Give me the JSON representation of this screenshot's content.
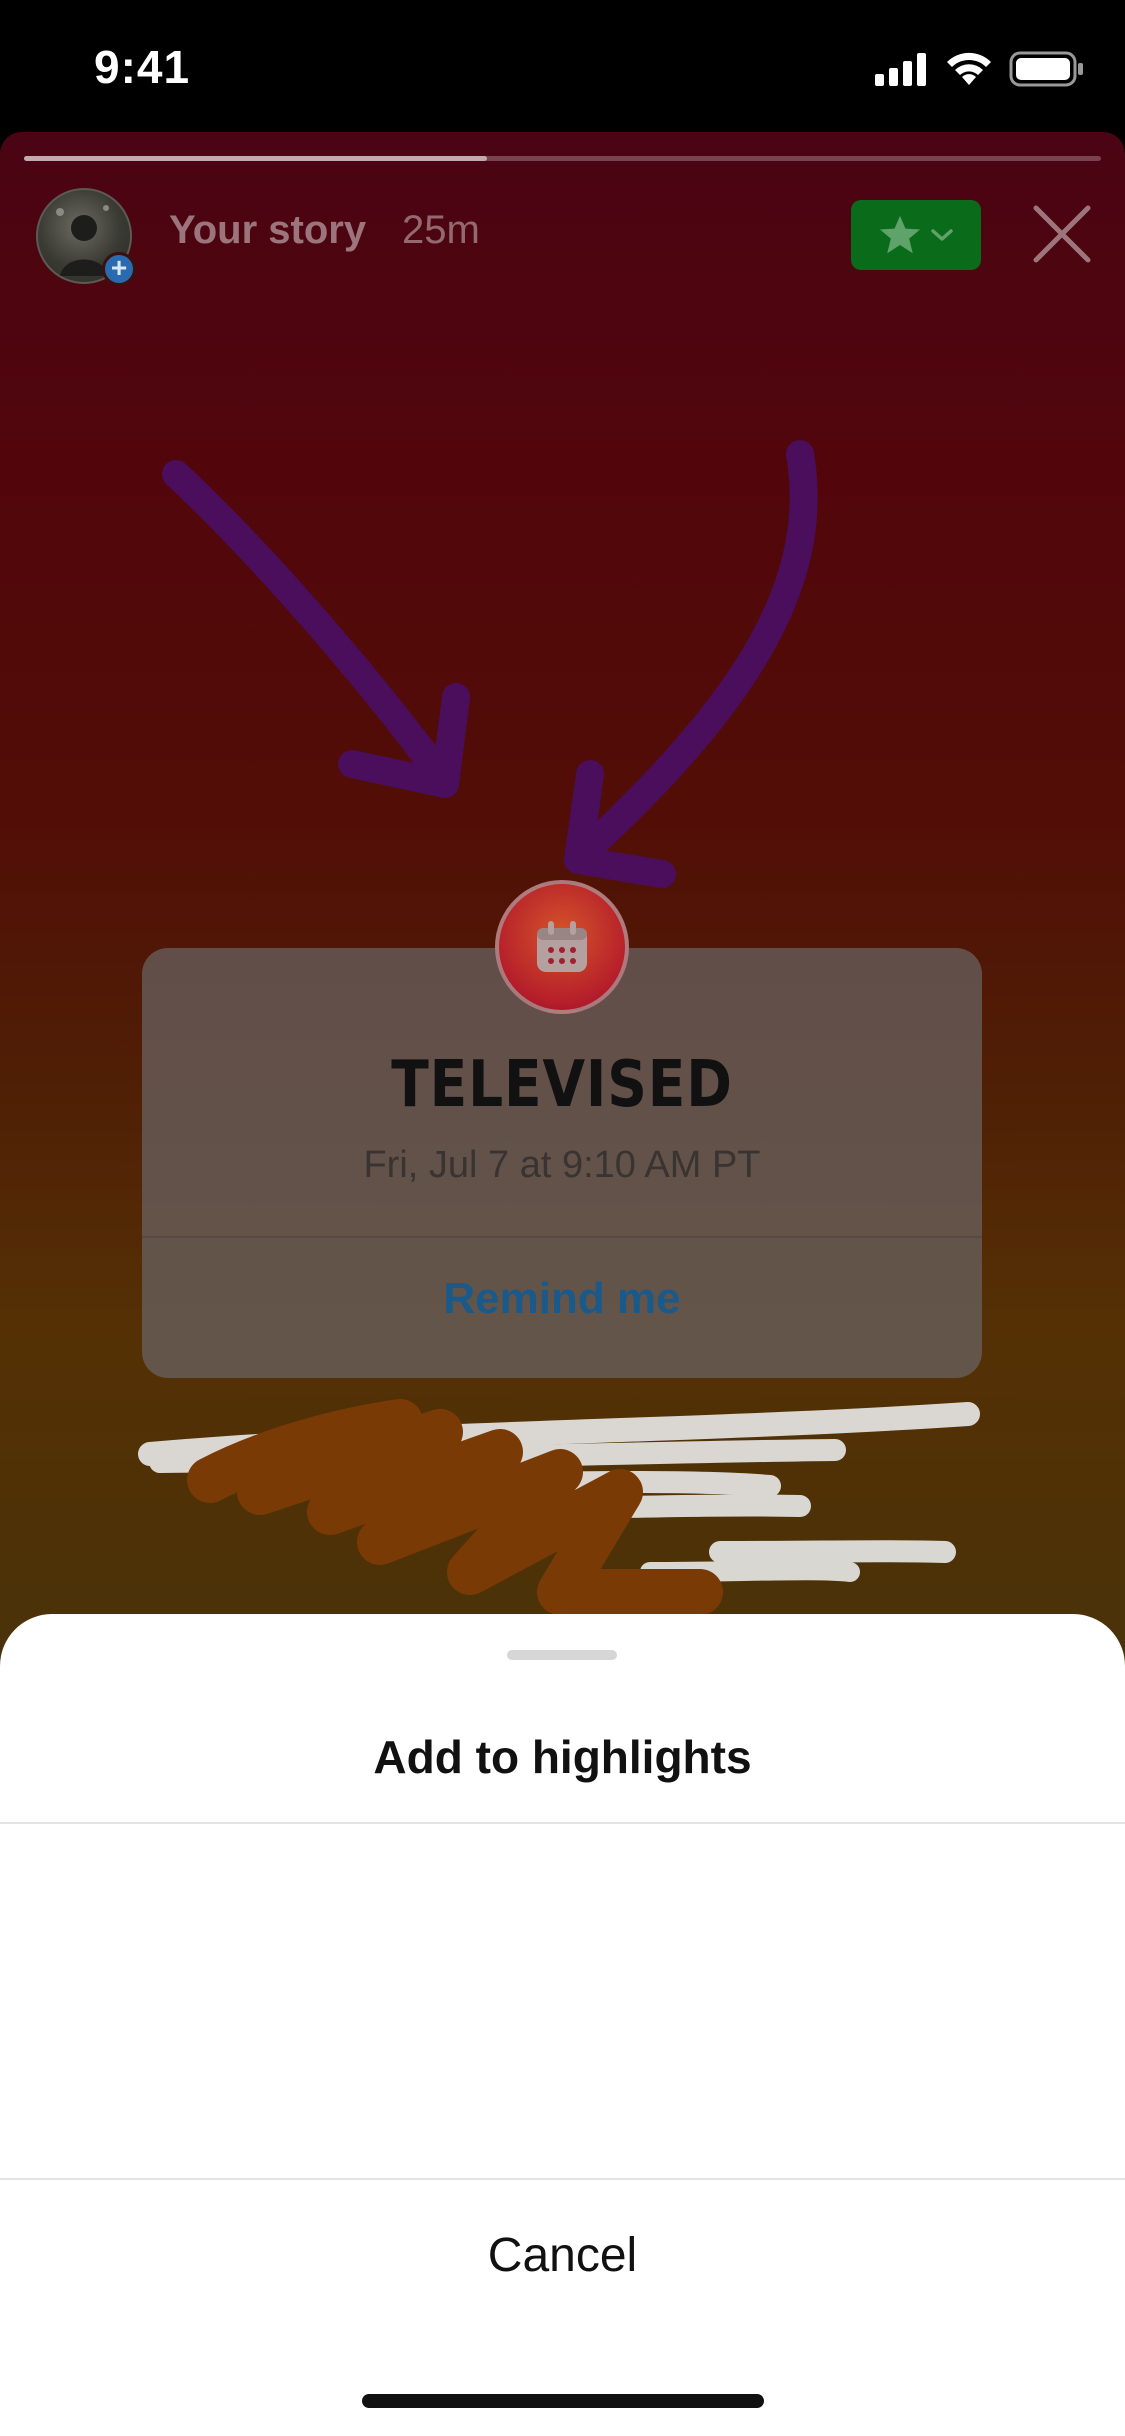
{
  "status_bar": {
    "time": "9:41",
    "icons": [
      "cellular-signal-icon",
      "wifi-icon",
      "battery-icon"
    ]
  },
  "story": {
    "owner_label": "Your story",
    "age": "25m",
    "progress": 0.43,
    "avatar_badge": "+",
    "audience_icon": "star-icon",
    "sticker": {
      "type": "event",
      "icon": "calendar-icon",
      "title": "TELEVISED",
      "date": "Fri, Jul 7 at 9:10 AM PT",
      "action": "Remind me"
    }
  },
  "sheet": {
    "title": "Add to highlights",
    "highlights": [],
    "cancel_label": "Cancel"
  },
  "colors": {
    "close_friends_green": "#0a6b1b",
    "remind_blue": "#1a5a8a",
    "sheet_bg": "#ffffff"
  }
}
